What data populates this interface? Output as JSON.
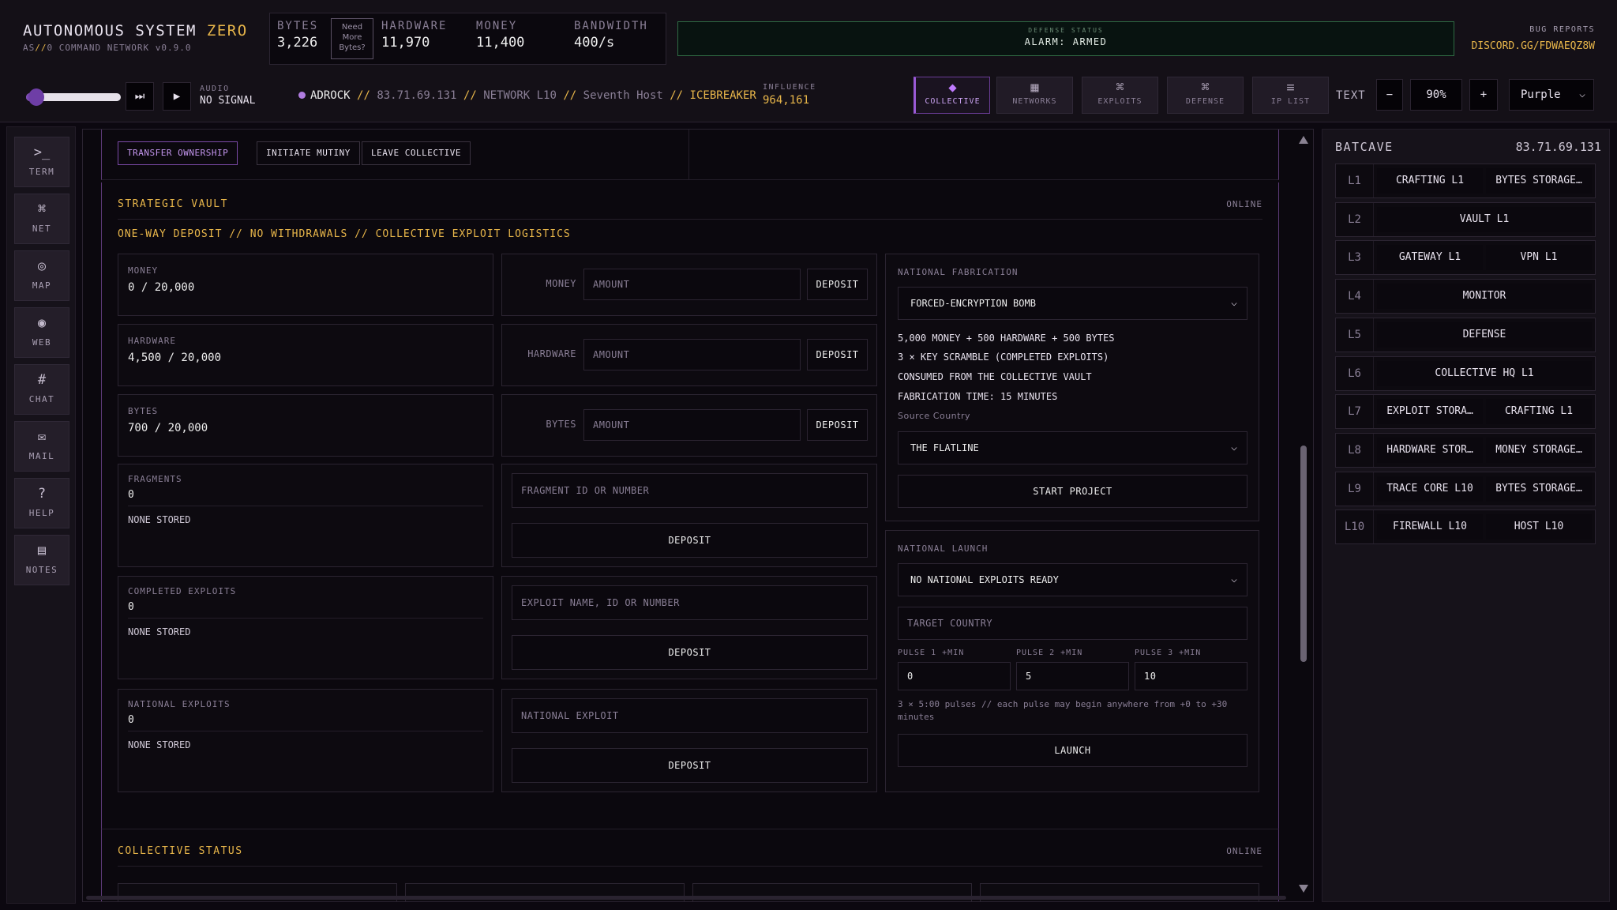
{
  "header": {
    "title_main": "AUTONOMOUS SYSTEM",
    "title_accent": "ZERO",
    "sub_prefix": "AS",
    "sub_slashes": "//",
    "sub_rest": "0 COMMAND NETWORK",
    "version": "v0.9.0",
    "resources": {
      "bytes_label": "BYTES",
      "bytes_value": "3,226",
      "need_more": "Need More Bytes?",
      "hardware_label": "HARDWARE",
      "hardware_value": "11,970",
      "money_label": "MONEY",
      "money_value": "11,400",
      "bandwidth_label": "BANDWIDTH",
      "bandwidth_value": "400/s"
    },
    "defense_status_label": "DEFENSE STATUS",
    "defense_status_value": "ALARM: ARMED",
    "bug_reports_label": "BUG REPORTS",
    "bug_reports_link": "DISCORD.GG/FDWAEQZ8W"
  },
  "player": {
    "audio_label": "AUDIO",
    "audio_value": "NO SIGNAL",
    "volume": 0.05,
    "skip_icon": "⏭",
    "play_icon": "▶",
    "name": "ADROCK",
    "sep": "//",
    "ip": "83.71.69.131",
    "network": "NETWORK L10",
    "host": "Seventh Host",
    "role": "ICEBREAKER",
    "influence_label": "INFLUENCE",
    "influence_value": "964,161"
  },
  "nav": [
    {
      "label": "COLLECTIVE",
      "icon": "◆",
      "active": true
    },
    {
      "label": "NETWORKS",
      "icon": "▦"
    },
    {
      "label": "EXPLOITS",
      "icon": "⌘"
    },
    {
      "label": "DEFENSE",
      "icon": "⌘"
    },
    {
      "label": "IP LIST",
      "icon": "≡"
    }
  ],
  "text_controls": {
    "label": "TEXT",
    "minus": "−",
    "zoom": "90%",
    "plus": "+",
    "theme": "Purple"
  },
  "rail": [
    {
      "label": "TERM",
      "icon": ">_"
    },
    {
      "label": "NET",
      "icon": "⌘"
    },
    {
      "label": "MAP",
      "icon": "◎"
    },
    {
      "label": "WEB",
      "icon": "◉"
    },
    {
      "label": "CHAT",
      "icon": "#"
    },
    {
      "label": "MAIL",
      "icon": "✉"
    },
    {
      "label": "HELP",
      "icon": "?"
    },
    {
      "label": "NOTES",
      "icon": "▤"
    }
  ],
  "ownership": {
    "transfer": "TRANSFER OWNERSHIP",
    "mutiny": "INITIATE MUTINY",
    "leave": "LEAVE COLLECTIVE"
  },
  "vault": {
    "title": "STRATEGIC VAULT",
    "status": "ONLINE",
    "subtitle": "ONE-WAY DEPOSIT // NO WITHDRAWALS // COLLECTIVE EXPLOIT LOGISTICS",
    "money": {
      "label": "MONEY",
      "value": "0 / 20,000",
      "input_label": "MONEY",
      "placeholder": "AMOUNT",
      "button": "DEPOSIT"
    },
    "hardware": {
      "label": "HARDWARE",
      "value": "4,500 / 20,000",
      "input_label": "HARDWARE",
      "placeholder": "AMOUNT",
      "button": "DEPOSIT"
    },
    "bytes": {
      "label": "BYTES",
      "value": "700 / 20,000",
      "input_label": "BYTES",
      "placeholder": "AMOUNT",
      "button": "DEPOSIT"
    },
    "fragments": {
      "label": "FRAGMENTS",
      "value": "0",
      "note": "NONE STORED",
      "placeholder": "FRAGMENT ID OR NUMBER",
      "button": "DEPOSIT"
    },
    "completed": {
      "label": "COMPLETED EXPLOITS",
      "value": "0",
      "note": "NONE STORED",
      "placeholder": "EXPLOIT NAME, ID OR NUMBER",
      "button": "DEPOSIT"
    },
    "national": {
      "label": "NATIONAL EXPLOITS",
      "value": "0",
      "note": "NONE STORED",
      "placeholder": "NATIONAL EXPLOIT",
      "button": "DEPOSIT"
    }
  },
  "fabrication": {
    "title": "NATIONAL FABRICATION",
    "selected": "FORCED-ENCRYPTION BOMB",
    "cost": "5,000 MONEY + 500 HARDWARE + 500 BYTES",
    "requires": "3 × KEY SCRAMBLE (COMPLETED EXPLOITS)",
    "consumed": "CONSUMED FROM THE COLLECTIVE VAULT",
    "time": "FABRICATION TIME: 15 MINUTES",
    "source_label": "Source Country",
    "source_value": "THE FLATLINE",
    "button": "START PROJECT"
  },
  "launch": {
    "title": "NATIONAL LAUNCH",
    "selected": "NO NATIONAL EXPLOITS READY",
    "target_placeholder": "TARGET COUNTRY",
    "pulse1_label": "PULSE 1 +MIN",
    "pulse1_value": "0",
    "pulse2_label": "PULSE 2 +MIN",
    "pulse2_value": "5",
    "pulse3_label": "PULSE 3 +MIN",
    "pulse3_value": "10",
    "note": "3 × 5:00 pulses // each pulse may begin anywhere from +0 to +30 minutes",
    "button": "LAUNCH"
  },
  "collective_status": {
    "title": "COLLECTIVE STATUS",
    "status": "ONLINE"
  },
  "batcave": {
    "title": "BATCAVE",
    "ip": "83.71.69.131",
    "levels": [
      {
        "level": "L1",
        "slots": [
          "CRAFTING L1",
          "BYTES STORAGE…"
        ]
      },
      {
        "level": "L2",
        "slots": [
          "VAULT L1"
        ]
      },
      {
        "level": "L3",
        "slots": [
          "GATEWAY L1",
          "VPN L1"
        ]
      },
      {
        "level": "L4",
        "slots": [
          "MONITOR"
        ]
      },
      {
        "level": "L5",
        "slots": [
          "DEFENSE"
        ]
      },
      {
        "level": "L6",
        "slots": [
          "COLLECTIVE HQ L1"
        ]
      },
      {
        "level": "L7",
        "slots": [
          "EXPLOIT STORA…",
          "CRAFTING L1"
        ]
      },
      {
        "level": "L8",
        "slots": [
          "HARDWARE STOR…",
          "MONEY STORAGE…"
        ]
      },
      {
        "level": "L9",
        "slots": [
          "TRACE CORE L10",
          "BYTES STORAGE…"
        ]
      },
      {
        "level": "L10",
        "slots": [
          "FIREWALL L10",
          "HOST L10"
        ]
      }
    ]
  },
  "colors": {
    "accent": "#9a5ad6",
    "gold": "#e8b64a",
    "armed": "#2f6b43"
  }
}
